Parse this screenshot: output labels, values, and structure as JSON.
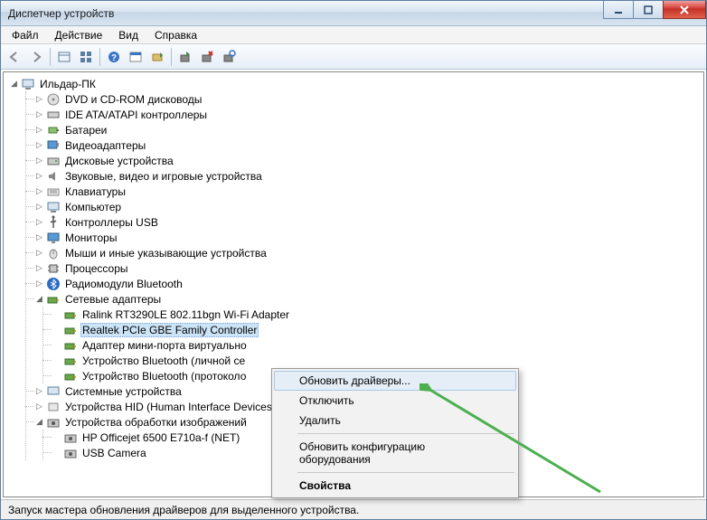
{
  "window": {
    "title": "Диспетчер устройств"
  },
  "menu": {
    "file": "Файл",
    "action": "Действие",
    "view": "Вид",
    "help": "Справка"
  },
  "root": "Ильдар-ПК",
  "cats": {
    "dvd": "DVD и CD-ROM дисководы",
    "ide": "IDE ATA/ATAPI контроллеры",
    "bat": "Батареи",
    "vid": "Видеоадаптеры",
    "disk": "Дисковые устройства",
    "snd": "Звуковые, видео и игровые устройства",
    "kb": "Клавиатуры",
    "comp": "Компьютер",
    "usb": "Контроллеры USB",
    "mon": "Мониторы",
    "mouse": "Мыши и иные указывающие устройства",
    "cpu": "Процессоры",
    "bt": "Радиомодули Bluetooth",
    "net": "Сетевые адаптеры",
    "sys": "Системные устройства",
    "hid": "Устройства HID (Human Interface Devices)",
    "img": "Устройства обработки изображений"
  },
  "net_children": {
    "ralink": "Ralink RT3290LE 802.11bgn Wi-Fi Adapter",
    "realtek": "Realtek PCIe GBE Family Controller",
    "miniport": "Адаптер мини-порта виртуально",
    "btdev1": "Устройство Bluetooth (личной се",
    "btdev2": "Устройство Bluetooth (протоколо"
  },
  "img_children": {
    "hp": "HP Officejet 6500 E710a-f (NET)",
    "cam": "USB Camera"
  },
  "ctx": {
    "update": "Обновить драйверы...",
    "disable": "Отключить",
    "remove": "Удалить",
    "scan": "Обновить конфигурацию оборудования",
    "props": "Свойства"
  },
  "status": "Запуск мастера обновления драйверов для выделенного устройства."
}
